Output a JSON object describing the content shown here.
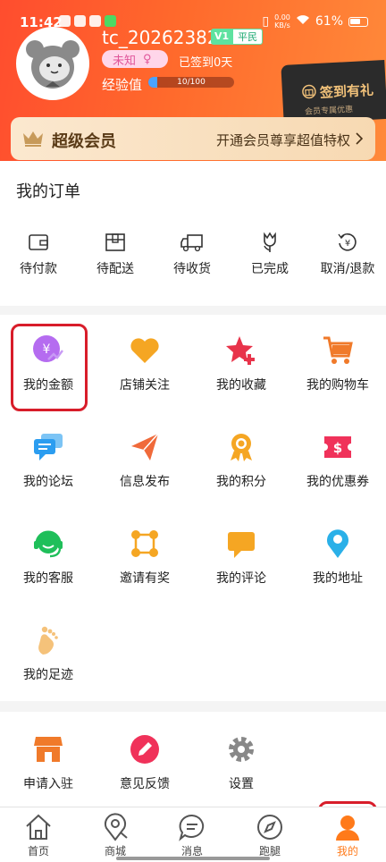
{
  "status_bar": {
    "time": "11:42",
    "net_speed": "0.00",
    "net_unit": "KB/s",
    "battery": "61%"
  },
  "profile": {
    "username": "tc_20262382",
    "level_badge": "V1",
    "level_name": "平民",
    "gender": "未知",
    "checkin_status": "已签到0天",
    "exp_label": "经验值",
    "exp_text": "10/100",
    "exp_progress": 0.1
  },
  "checkin_card": {
    "title": "签到有礼",
    "subtitle": "会员专属优惠"
  },
  "vip": {
    "title": "超级会员",
    "promo": "开通会员尊享超值特权"
  },
  "orders": {
    "title": "我的订单",
    "items": [
      {
        "label": "待付款",
        "icon": "wallet-icon"
      },
      {
        "label": "待配送",
        "icon": "box-icon"
      },
      {
        "label": "待收货",
        "icon": "truck-icon"
      },
      {
        "label": "已完成",
        "icon": "tulip-icon"
      },
      {
        "label": "取消/退款",
        "icon": "refund-icon"
      }
    ]
  },
  "services": [
    {
      "label": "我的金额",
      "icon": "yuan-coin-icon",
      "color": "#b56cf0"
    },
    {
      "label": "店铺关注",
      "icon": "heart-icon",
      "color": "#f5a623"
    },
    {
      "label": "我的收藏",
      "icon": "star-plus-icon",
      "color": "#e8334a"
    },
    {
      "label": "我的购物车",
      "icon": "cart-icon",
      "color": "#f07a2a"
    },
    {
      "label": "我的论坛",
      "icon": "chat-bubbles-icon",
      "color": "#2b9df0"
    },
    {
      "label": "信息发布",
      "icon": "paper-plane-icon",
      "color": "#f06a3a"
    },
    {
      "label": "我的积分",
      "icon": "medal-icon",
      "color": "#f5a623"
    },
    {
      "label": "我的优惠券",
      "icon": "coupon-icon",
      "color": "#f0325a"
    },
    {
      "label": "我的客服",
      "icon": "headset-icon",
      "color": "#1fbf5a"
    },
    {
      "label": "邀请有奖",
      "icon": "share-nodes-icon",
      "color": "#f5a623"
    },
    {
      "label": "我的评论",
      "icon": "comment-icon",
      "color": "#f5a623"
    },
    {
      "label": "我的地址",
      "icon": "location-pin-icon",
      "color": "#2ab0e8"
    },
    {
      "label": "我的足迹",
      "icon": "footprint-icon",
      "color": "#f5c27a"
    }
  ],
  "extras": [
    {
      "label": "申请入驻",
      "icon": "storefront-icon",
      "color": "#f07a2a"
    },
    {
      "label": "意见反馈",
      "icon": "pencil-circle-icon",
      "color": "#f0325a"
    },
    {
      "label": "设置",
      "icon": "gear-icon",
      "color": "#888888"
    }
  ],
  "tabs": [
    {
      "label": "首页",
      "icon": "home-icon",
      "active": false
    },
    {
      "label": "商城",
      "icon": "map-pin-icon",
      "active": false
    },
    {
      "label": "消息",
      "icon": "message-icon",
      "active": false
    },
    {
      "label": "跑腿",
      "icon": "compass-icon",
      "active": false
    },
    {
      "label": "我的",
      "icon": "user-icon",
      "active": true
    }
  ],
  "colors": {
    "header": "#ff5a2e",
    "accent": "#ff7a1a",
    "highlight": "#d81d2a"
  }
}
